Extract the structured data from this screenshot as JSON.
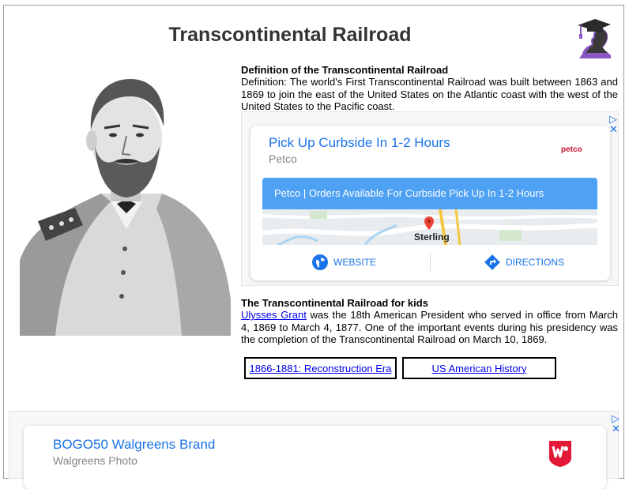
{
  "page": {
    "title": "Transcontinental Railroad"
  },
  "definition": {
    "heading": "Definition of the Transcontinental Railroad",
    "text": "Definition: The world's First Transcontinental Railroad was built between 1863 and 1869 to join the east of the United States on the Atlantic coast with the west of the United States to the Pacific coast."
  },
  "ad_petco": {
    "headline": "Pick Up Curbside In 1-2 Hours",
    "advertiser": "Petco",
    "brand_logo_text": "petco",
    "banner": "Petco | Orders Available For Curbside Pick Up In 1-2 Hours",
    "map_label": "Sterling",
    "website_label": "WEBSITE",
    "directions_label": "DIRECTIONS",
    "ad_choices_label": "▷",
    "close_label": "✕"
  },
  "kids": {
    "heading": "The Transcontinental Railroad for kids",
    "link_text": "Ulysses Grant",
    "text_rest": " was the 18th American President who served in office from March 4, 1869 to March 4, 1877. One of the important events during his presidency was the completion of the Transcontinental Railroad on March 10, 1869."
  },
  "nav_buttons": {
    "reconstruction": "1866-1881: Reconstruction Era",
    "history": "US American History"
  },
  "ad_walgreens": {
    "headline": "BOGO50 Walgreens Brand",
    "advertiser": "Walgreens Photo",
    "ad_choices_label": "▷",
    "close_label": "✕"
  },
  "colors": {
    "ad_link_blue": "#1a73e8",
    "banner_blue": "#4ea1f3",
    "walgreens_red": "#e31837",
    "logo_purple": "#8a57c5"
  }
}
